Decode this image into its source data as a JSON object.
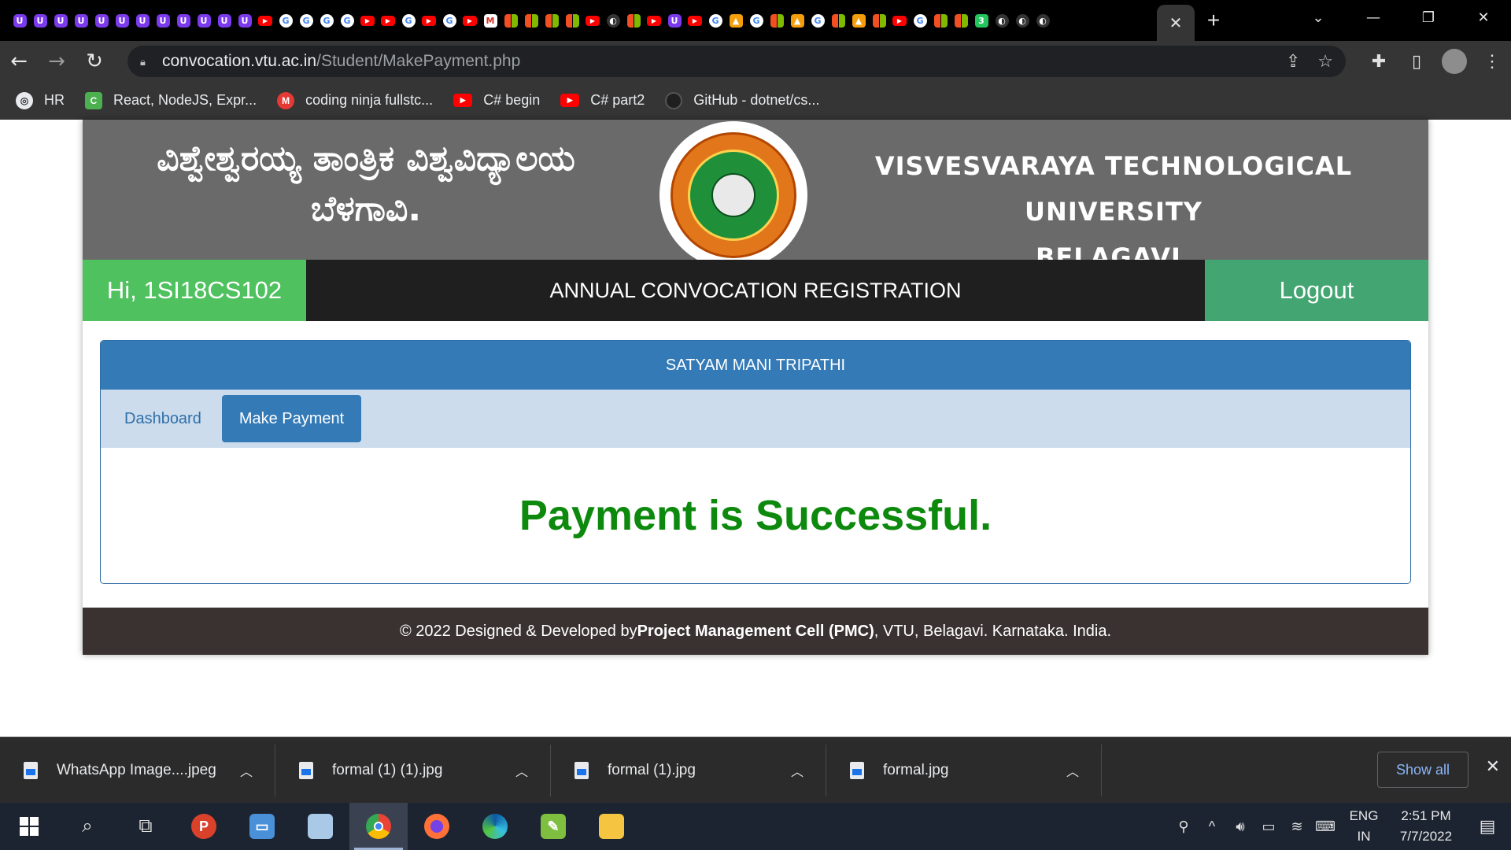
{
  "browser": {
    "url_host": "convocation.vtu.ac.in",
    "url_path": "/Student/MakePayment.php",
    "tab_favicons": [
      "purple",
      "purple",
      "purple",
      "purple",
      "purple",
      "purple",
      "purple",
      "purple",
      "purple",
      "purple",
      "purple",
      "purple",
      "yt",
      "g",
      "g",
      "g",
      "g",
      "yt",
      "yt",
      "g",
      "yt",
      "g",
      "yt",
      "gmail",
      "ms",
      "ms",
      "ms",
      "ms",
      "yt",
      "dark",
      "ms",
      "yt",
      "purple",
      "yt",
      "g",
      "orange",
      "g",
      "ms",
      "orange",
      "g",
      "ms",
      "orange",
      "ms",
      "yt",
      "g",
      "ms",
      "ms",
      "green",
      "dark",
      "dark",
      "dark"
    ],
    "bookmarks": [
      {
        "label": "HR",
        "icon": "world"
      },
      {
        "label": "React, NodeJS, Expr...",
        "icon": "codi"
      },
      {
        "label": "coding ninja fullstc...",
        "icon": "cn"
      },
      {
        "label": "C# begin",
        "icon": "yt"
      },
      {
        "label": "C# part2",
        "icon": "yt"
      },
      {
        "label": "GitHub - dotnet/cs...",
        "icon": "gh"
      }
    ]
  },
  "header": {
    "kannada_line1": "ವಿಶ್ವೇಶ್ವರಯ್ಯ ತಾಂತ್ರಿಕ ವಿಶ್ವವಿದ್ಯಾಲಯ",
    "kannada_line2": "ಬೆಳಗಾವಿ.",
    "english_line1": "VISVESVARAYA TECHNOLOGICAL UNIVERSITY",
    "english_line2": "BELAGAVI."
  },
  "topbar": {
    "greeting": "Hi, 1SI18CS102",
    "title": "ANNUAL CONVOCATION REGISTRATION",
    "logout": "Logout"
  },
  "panel": {
    "student_name": "SATYAM MANI TRIPATHI",
    "tabs": [
      {
        "label": "Dashboard",
        "active": false
      },
      {
        "label": "Make Payment",
        "active": true
      }
    ],
    "message": "Payment is Successful."
  },
  "footer": {
    "prefix": "© 2022 Designed & Developed by ",
    "bold": "Project Management Cell (PMC)",
    "suffix": ", VTU, Belagavi. Karnataka. India."
  },
  "downloads": {
    "items": [
      {
        "name": "WhatsApp Image....jpeg"
      },
      {
        "name": "formal (1) (1).jpg"
      },
      {
        "name": "formal (1).jpg"
      },
      {
        "name": "formal.jpg"
      }
    ],
    "show_all": "Show all"
  },
  "taskbar": {
    "lang_line1": "ENG",
    "lang_line2": "IN",
    "time": "2:51 PM",
    "date": "7/7/2022"
  },
  "colors": {
    "success_green": "#0d8a0d",
    "primary_blue": "#337ab7",
    "greeting_green": "#4fc15f",
    "logout_green": "#43a571"
  }
}
